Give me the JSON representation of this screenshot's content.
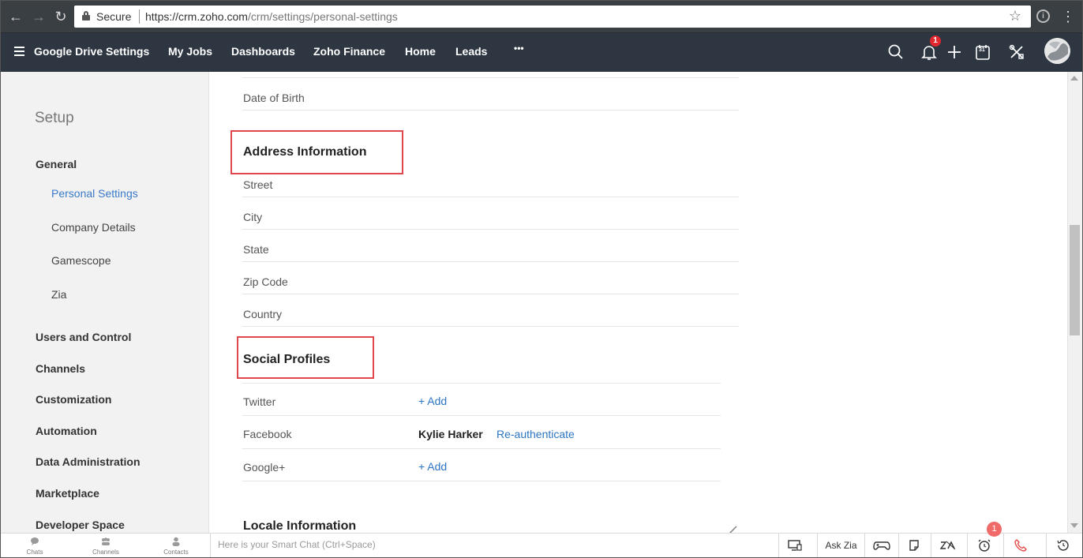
{
  "browser": {
    "secure_label": "Secure",
    "url_host": "https://crm.zoho.com",
    "url_path": "/crm/settings/personal-settings"
  },
  "header": {
    "nav": [
      "Google Drive Settings",
      "My Jobs",
      "Dashboards",
      "Zoho Finance",
      "Home",
      "Leads"
    ],
    "more": "•••",
    "notification_count": "1",
    "calendar_day": "31"
  },
  "sidebar": {
    "title": "Setup",
    "general": "General",
    "general_items": [
      "Personal Settings",
      "Company Details",
      "Gamescope",
      "Zia"
    ],
    "groups": [
      "Users and Control",
      "Channels",
      "Customization",
      "Automation",
      "Data Administration",
      "Marketplace",
      "Developer Space"
    ]
  },
  "main": {
    "date_of_birth": "Date of Birth",
    "address_title": "Address Information",
    "address_fields": [
      "Street",
      "City",
      "State",
      "Zip Code",
      "Country"
    ],
    "social_title": "Social Profiles",
    "social": {
      "twitter": "Twitter",
      "twitter_action": "+ Add",
      "facebook": "Facebook",
      "facebook_user": "Kylie Harker",
      "facebook_action": "Re-authenticate",
      "google": "Google+",
      "google_action": "+ Add"
    },
    "locale_title": "Locale Information"
  },
  "bottombar": {
    "chats": "Chats",
    "channels": "Channels",
    "contacts": "Contacts",
    "smartchat_placeholder": "Here is your Smart Chat (Ctrl+Space)",
    "ask_zia": "Ask Zia",
    "reminder_count": "1"
  }
}
